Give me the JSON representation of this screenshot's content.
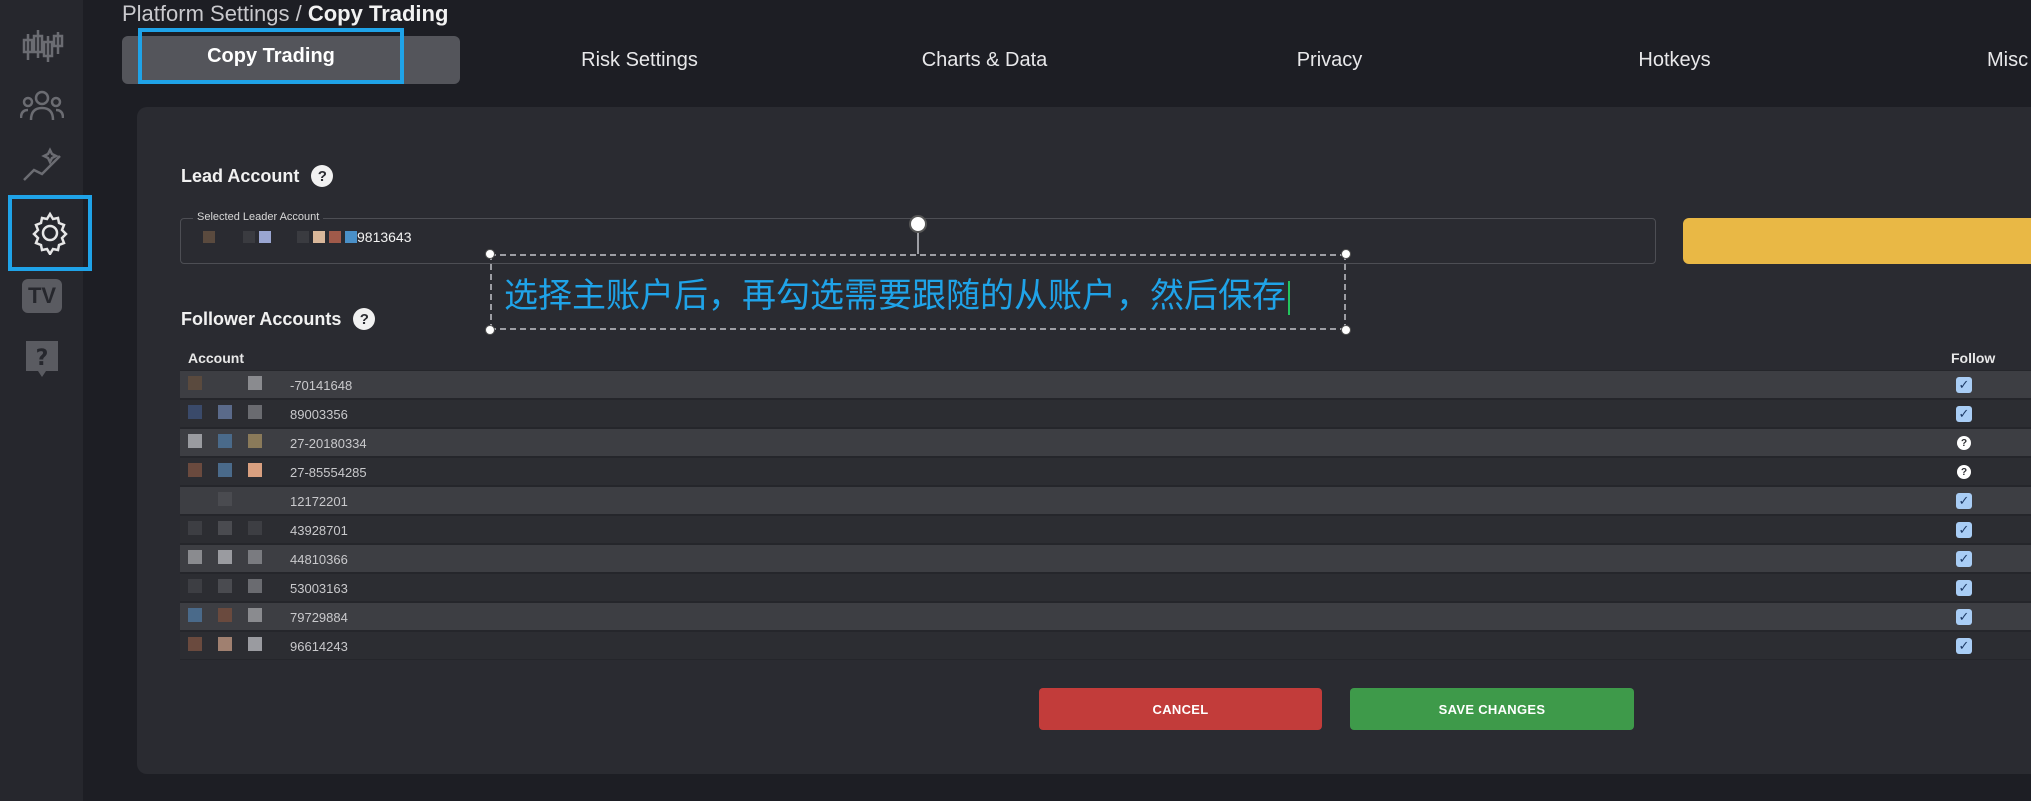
{
  "breadcrumb": {
    "parent": "Platform Settings / ",
    "current": "Copy Trading"
  },
  "tabs": [
    "Copy Trading",
    "Risk Settings",
    "Charts & Data",
    "Privacy",
    "Hotkeys",
    "Misc"
  ],
  "sidebar": {
    "icons": [
      "candlestick-chart-icon",
      "users-icon",
      "stats-sparkle-icon",
      "gear-icon",
      "tv-icon",
      "help-icon"
    ],
    "tv_label": "TV"
  },
  "lead": {
    "title": "Lead Account",
    "help": "?",
    "field_label": "Selected Leader Account",
    "value_suffix": "9813643"
  },
  "annotation": {
    "text": "选择主账户后，再勾选需要跟随的从账户，然后保存"
  },
  "followers": {
    "title": "Follower Accounts",
    "help": "?",
    "col_account": "Account",
    "col_follow": "Follow",
    "rows": [
      {
        "account": "-70141648",
        "follow": "checked"
      },
      {
        "account": "89003356",
        "follow": "checked"
      },
      {
        "account": "27-20180334",
        "follow": "unknown"
      },
      {
        "account": "27-85554285",
        "follow": "unknown"
      },
      {
        "account": "12172201",
        "follow": "checked"
      },
      {
        "account": "43928701",
        "follow": "checked"
      },
      {
        "account": "44810366",
        "follow": "checked"
      },
      {
        "account": "53003163",
        "follow": "checked"
      },
      {
        "account": "79729884",
        "follow": "checked"
      },
      {
        "account": "96614243",
        "follow": "checked"
      }
    ]
  },
  "actions": {
    "cancel": "CANCEL",
    "save": "SAVE CHANGES"
  },
  "colors": {
    "accent": "#1fa3e8",
    "cancel": "#c23c3a",
    "save": "#3e9a4a",
    "yellow": "#e9b845"
  }
}
